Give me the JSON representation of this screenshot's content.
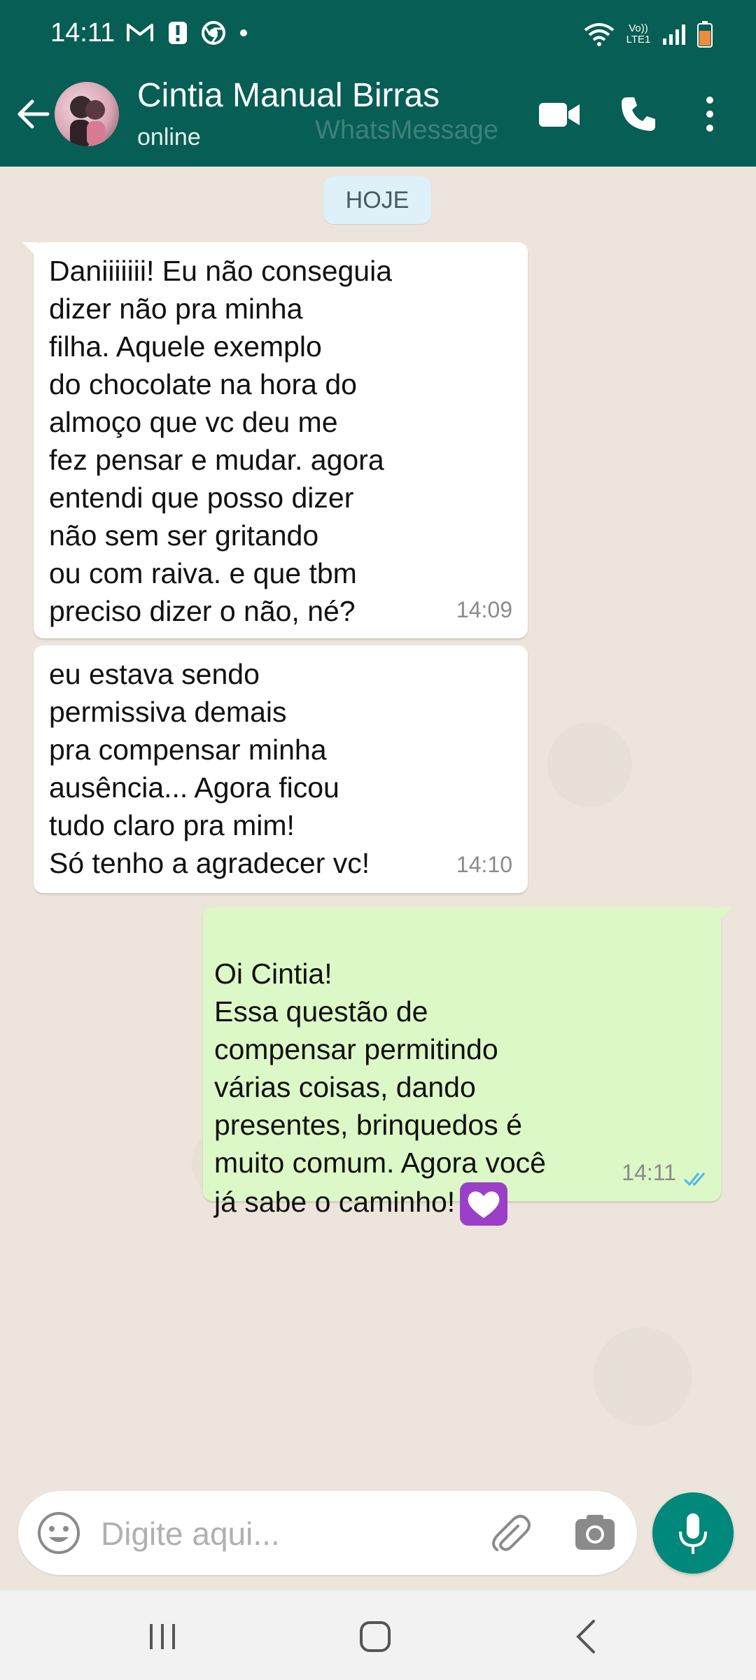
{
  "status_bar": {
    "time": "14:11",
    "left_icons": [
      "gmail-icon",
      "alert-icon",
      "chrome-icon",
      "dot-icon"
    ],
    "right_icons": [
      "wifi-icon",
      "volte-icon",
      "signal-icon",
      "battery-icon"
    ],
    "volte_label": "Vo)) LTE1"
  },
  "header": {
    "contact_name": "Cintia Manual Birras",
    "status": "online",
    "watermark": "WhatsMessage",
    "background_color": "#075e54"
  },
  "chat": {
    "date_chip": "HOJE",
    "messages": [
      {
        "direction": "incoming",
        "text": "Daniiiiiii! Eu não conseguia\ndizer não pra minha\nfilha. Aquele exemplo\ndo chocolate na hora do\nalmoço que vc deu me\nfez pensar e mudar. agora\nentendi que posso dizer\nnão sem ser gritando\nou com raiva. e que tbm\npreciso dizer o não, né?",
        "time": "14:09"
      },
      {
        "direction": "incoming",
        "text": "eu estava sendo\npermissiva demais\npra compensar minha\nausência... Agora ficou\ntudo claro pra mim!\nSó tenho a agradecer vc!",
        "time": "14:10"
      },
      {
        "direction": "outgoing",
        "text": "Oi Cintia!\nEssa questão de\ncompensar permitindo\nvárias coisas, dando\npresentes, brinquedos é\nmuito comum. Agora você\njá sabe o caminho!",
        "emoji": "purple-heart-icon",
        "time": "14:11",
        "read_status": "double-check-read"
      }
    ]
  },
  "input_bar": {
    "placeholder": "Digite aqui..."
  },
  "colors": {
    "incoming_bubble": "#ffffff",
    "outgoing_bubble": "#dcf8c6",
    "mic_button": "#00897b",
    "read_ticks": "#4fb6ec"
  }
}
